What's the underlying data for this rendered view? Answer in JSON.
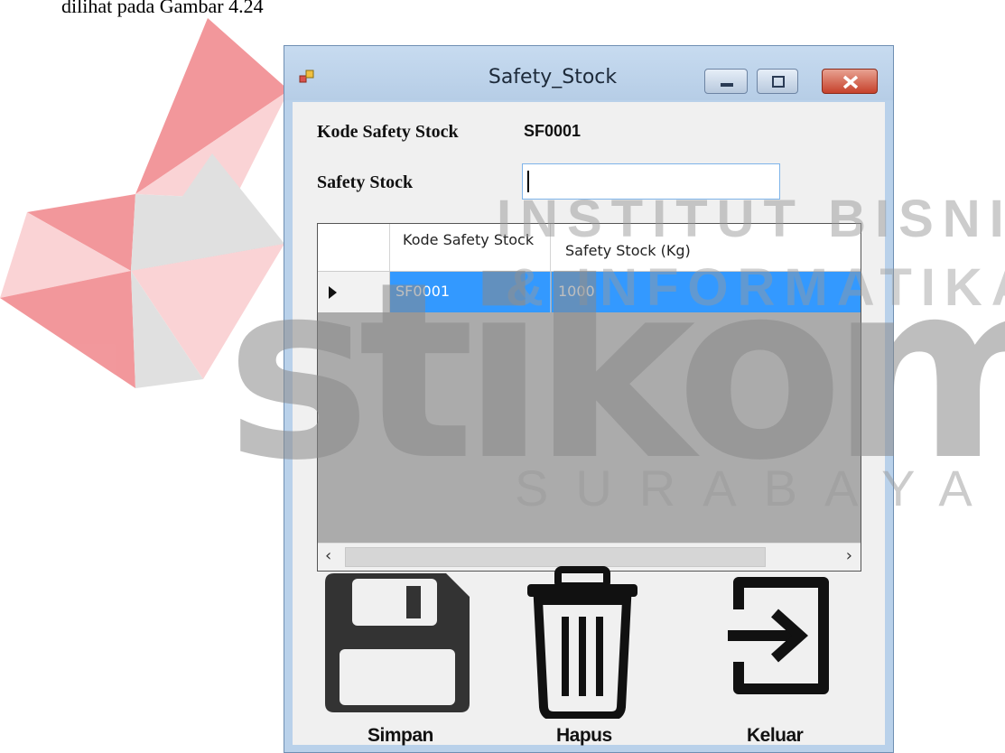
{
  "document": {
    "caption": "dilihat pada Gambar 4.24"
  },
  "watermark": {
    "line1": "INSTITUT BISNIS",
    "line2": "& INFORMATIKA",
    "brand": "stikom",
    "city": "SURABAYA"
  },
  "window": {
    "title": "Safety_Stock",
    "controls": [
      "minimize-icon",
      "maximize-icon",
      "close-icon"
    ]
  },
  "form": {
    "kode_label": "Kode Safety Stock",
    "kode_value": "SF0001",
    "safety_label": "Safety Stock",
    "safety_value": ""
  },
  "grid": {
    "columns": [
      "Kode Safety Stock",
      "Safety Stock (Kg)"
    ],
    "rows": [
      {
        "kode": "SF0001",
        "stock": "1000",
        "selected": true
      }
    ]
  },
  "actions": {
    "save": {
      "label": "Simpan",
      "icon": "floppy-disk-icon"
    },
    "delete": {
      "label": "Hapus",
      "icon": "trash-icon"
    },
    "exit": {
      "label": "Keluar",
      "icon": "exit-icon"
    }
  },
  "colors": {
    "selection": "#3399ff",
    "watermark_red": "#e8434a"
  }
}
